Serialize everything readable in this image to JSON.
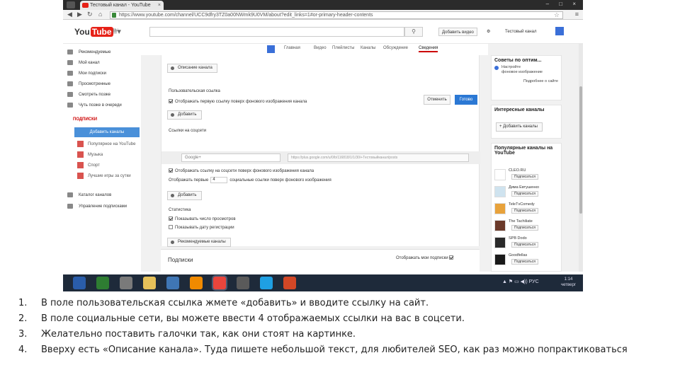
{
  "browser": {
    "tab_title": "Тестовый канал - YouTube",
    "tab_close": "×",
    "window_controls": "– □ ×",
    "url": "https://www.youtube.com/channel/UCC9dfry3TZ0a00NWmk9U0VM/about?edit_links=1#or-primary-header-contents"
  },
  "header": {
    "logo_text": "You",
    "logo_tube": "Tube",
    "logo_region": "RU",
    "upload_button": "Добавить видео",
    "channel_button": "Тестовый канал"
  },
  "sidebar": {
    "items": [
      {
        "label": "Рекомендуемые"
      },
      {
        "label": "Мой канал"
      },
      {
        "label": "Мои подписки"
      },
      {
        "label": "Просмотренные"
      },
      {
        "label": "Смотреть позже"
      },
      {
        "label": "Чуть позже в очереди"
      }
    ],
    "subscriptions_heading": "ПОДПИСКИ",
    "selected_item": "Добавить каналы",
    "subs": [
      {
        "label": "Популярное на YouTube",
        "color": "#d9534f"
      },
      {
        "label": "Музыка",
        "color": "#e0573a"
      },
      {
        "label": "Спорт",
        "color": "#e06a2a"
      },
      {
        "label": "Лучшие игры за сутки",
        "color": "#d04a4a"
      }
    ],
    "bottom_items": [
      {
        "label": "Каталог каналов"
      },
      {
        "label": "Управление подписками"
      }
    ]
  },
  "channel_tabs": [
    "Главная",
    "Видео",
    "Плейлисты",
    "Каналы",
    "Обсуждение",
    "Сведения"
  ],
  "active_tab": "Сведения",
  "form": {
    "description_button": "Описание канала",
    "custom_links_label": "Пользовательская ссылка",
    "cancel_label": "Отменить",
    "save_label": "Готово",
    "custom_overlay_checkbox": "Отображать первую ссылку поверх фонового изображения канала",
    "add_button_1": "Добавить",
    "social_label": "Ссылки на соцсети",
    "social_select": "Google+",
    "social_url": "https://plus.google.com/u/0/b/116818/1/1/30/+Тестовыйканал/posts",
    "social_overlay_checkbox": "Отображать ссылку на соцсети поверх фонового изображения канала",
    "show_count_prefix": "Отображать первые",
    "show_count_value": "4",
    "show_count_suffix": "социальные ссылки поверх фонового изображения",
    "add_button_2": "Добавить",
    "stats_label": "Статистика",
    "stats_checkbox_1": "Показывать число просмотров",
    "stats_checkbox_2": "Показывать дату регистрации",
    "recommended_button": "Рекомендуемые каналы",
    "subscriptions_title": "Подписки",
    "subscriptions_visibility": "Отображать мои подписки"
  },
  "right_panel": {
    "tips_title": "Советы по оптим...",
    "tips_lines": [
      "Настройте",
      "фоновое изображение"
    ],
    "tips_link": "Подробнее о сайте",
    "interesting_title": "Интересные каналы",
    "add_channels_button": "+ Добавить каналы",
    "popular_title": "Популярные каналы на YouTube",
    "subscribe_label": "Подписаться",
    "channels": [
      {
        "name": "CLEO.RU",
        "color": "#ffffff"
      },
      {
        "name": "Дима Евтушенко",
        "color": "#cfe3ef"
      },
      {
        "name": "TeleTvComedy",
        "color": "#e8a23b"
      },
      {
        "name": "The Tachiliate",
        "color": "#6b3a2a"
      },
      {
        "name": "SPB Dodo",
        "color": "#2a2a2a"
      },
      {
        "name": "Goodfellas",
        "color": "#1a1a1a"
      }
    ]
  },
  "taskbar": {
    "apps": [
      {
        "name": "word-icon",
        "color": "#2a5daa"
      },
      {
        "name": "excel-icon",
        "color": "#2e7d32"
      },
      {
        "name": "calculator-icon",
        "color": "#7a7a7a"
      },
      {
        "name": "folder-icon",
        "color": "#e6c15a"
      },
      {
        "name": "globe-icon",
        "color": "#3f76b5"
      },
      {
        "name": "vlc-icon",
        "color": "#f08a00"
      },
      {
        "name": "chrome-icon",
        "color": "#e8453c"
      },
      {
        "name": "inkscape-icon",
        "color": "#5a5a5a"
      },
      {
        "name": "skype-icon",
        "color": "#1fa0e3"
      },
      {
        "name": "powerpoint-icon",
        "color": "#d24726"
      }
    ],
    "language": "РУС",
    "time": "1:14",
    "day": "четверг"
  },
  "notes": [
    {
      "num": "1.",
      "text": "В поле пользовательская ссылка жмете «добавить» и вводите ссылку на сайт."
    },
    {
      "num": "2.",
      "text": "В поле социальные сети, вы можете ввести 4 отображаемых ссылки на вас в соцсети."
    },
    {
      "num": "3.",
      "text": "Желательно поставить галочки так, как они стоят на картинке."
    },
    {
      "num": "4.",
      "text": "Вверху есть «Описание канала». Туда пишете небольшой текст, для любителей SEO, как раз можно попрактиковаться"
    }
  ]
}
